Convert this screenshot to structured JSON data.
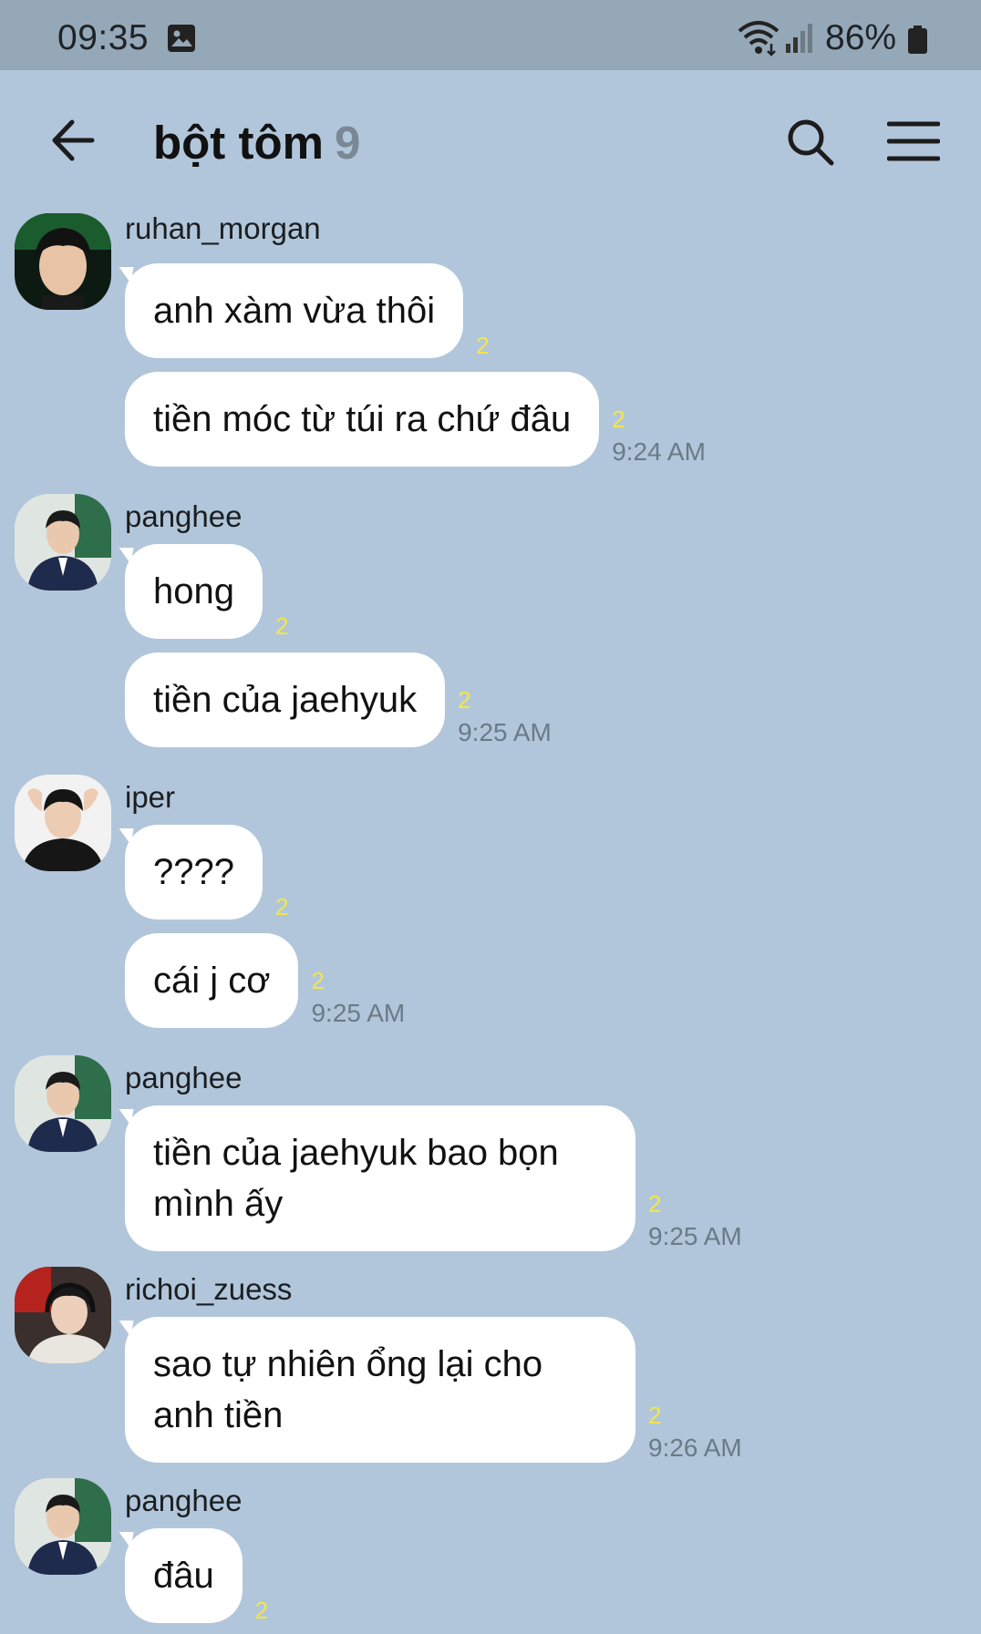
{
  "status_bar": {
    "time": "09:35",
    "battery": "86%",
    "icons": [
      "gallery-icon",
      "wifi-icon",
      "signal-icon",
      "battery-icon"
    ]
  },
  "header": {
    "title": "bột tôm",
    "member_count": "9",
    "icons": [
      "back-arrow-icon",
      "search-icon",
      "menu-icon"
    ]
  },
  "colors": {
    "background": "#b1c6da",
    "status_bar": "#95a8b8",
    "bubble": "#ffffff",
    "unread": "#f3e64a",
    "timestamp": "#6b7a87"
  },
  "groups": [
    {
      "sender": "ruhan_morgan",
      "messages": [
        {
          "text": "anh xàm vừa thôi",
          "unread": "2",
          "time": ""
        },
        {
          "text": "tiền móc từ túi ra chứ đâu",
          "unread": "2",
          "time": "9:24 AM"
        }
      ]
    },
    {
      "sender": "panghee",
      "messages": [
        {
          "text": "hong",
          "unread": "2",
          "time": ""
        },
        {
          "text": "tiền của jaehyuk",
          "unread": "2",
          "time": "9:25 AM"
        }
      ]
    },
    {
      "sender": "iper",
      "messages": [
        {
          "text": "????",
          "unread": "2",
          "time": ""
        },
        {
          "text": "cái j cơ",
          "unread": "2",
          "time": "9:25 AM"
        }
      ]
    },
    {
      "sender": "panghee",
      "messages": [
        {
          "text": "tiền của jaehyuk bao bọn mình ấy",
          "unread": "2",
          "time": "9:25 AM"
        }
      ]
    },
    {
      "sender": "richoi_zuess",
      "messages": [
        {
          "text": "sao tự nhiên ổng lại cho anh tiền",
          "unread": "2",
          "time": "9:26 AM"
        }
      ]
    },
    {
      "sender": "panghee",
      "messages": [
        {
          "text": "đâu",
          "unread": "2",
          "time": ""
        }
      ]
    }
  ]
}
